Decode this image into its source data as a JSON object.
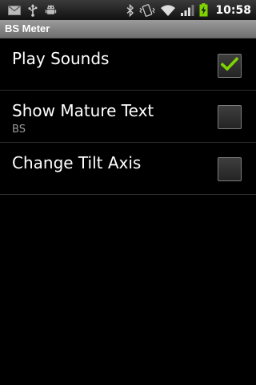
{
  "status_bar": {
    "time": "10:58",
    "icons": [
      "mail-icon",
      "usb-icon",
      "android-debug-icon",
      "bluetooth-icon",
      "vibrate-icon",
      "wifi-icon",
      "signal-icon",
      "battery-charging-icon"
    ]
  },
  "app": {
    "title": "BS Meter"
  },
  "preferences": [
    {
      "title": "Play Sounds",
      "summary": "",
      "checked": true
    },
    {
      "title": "Show Mature Text",
      "summary": "BS",
      "checked": false
    },
    {
      "title": "Change Tilt Axis",
      "summary": "",
      "checked": false
    }
  ],
  "colors": {
    "check_green": "#7fd400",
    "background": "#000000",
    "divider": "#2c2c2c"
  }
}
